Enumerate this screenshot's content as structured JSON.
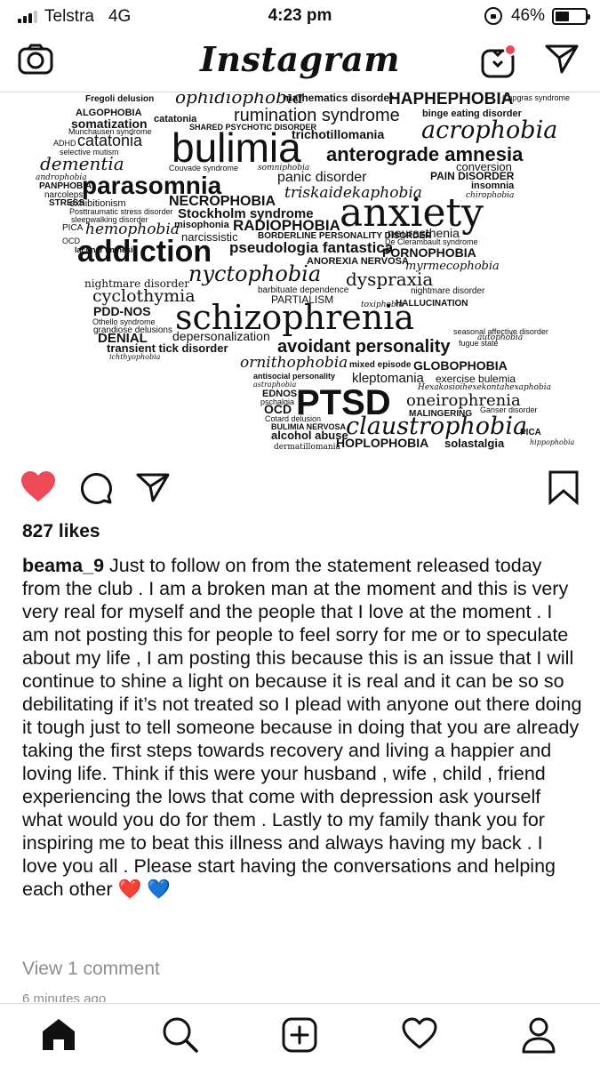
{
  "status_bar": {
    "carrier": "Telstra",
    "network": "4G",
    "time": "4:23 pm",
    "battery_percent_label": "46%",
    "battery_level": 0.46
  },
  "top_nav": {
    "logo": "Instagram",
    "icons": [
      "camera-icon",
      "igtv-icon",
      "direct-send-icon"
    ]
  },
  "post_image": {
    "words": [
      {
        "t": "ophidiophobia"
      },
      {
        "t": "mathematics disorder"
      },
      {
        "t": "HAPHEPHOBIA"
      },
      {
        "t": "Fregoli delusion"
      },
      {
        "t": "Capgras syndrome"
      },
      {
        "t": "ALGOPHOBIA"
      },
      {
        "t": "rumination syndrome"
      },
      {
        "t": "binge eating disorder"
      },
      {
        "t": "somatization"
      },
      {
        "t": "catatonia"
      },
      {
        "t": "Munchausen syndrome"
      },
      {
        "t": "SHARED PSYCHOTIC DISORDER"
      },
      {
        "t": "trichotillomania"
      },
      {
        "t": "acrophobia"
      },
      {
        "t": "ADHD"
      },
      {
        "t": "catatonia"
      },
      {
        "t": "bulimia"
      },
      {
        "t": "selective mutism"
      },
      {
        "t": "anterograde amnesia"
      },
      {
        "t": "dementia"
      },
      {
        "t": "Couvade syndrome"
      },
      {
        "t": "somniphobia"
      },
      {
        "t": "conversion"
      },
      {
        "t": "androphobia"
      },
      {
        "t": "PANPHOBIA"
      },
      {
        "t": "parasomnia"
      },
      {
        "t": "panic disorder"
      },
      {
        "t": "PAIN DISORDER"
      },
      {
        "t": "narcolepsy"
      },
      {
        "t": "insomnia"
      },
      {
        "t": "STRESS"
      },
      {
        "t": "triskaidekaphobia"
      },
      {
        "t": "chirophobia"
      },
      {
        "t": "exhibitionism"
      },
      {
        "t": "NECROPHOBIA"
      },
      {
        "t": "anxiety"
      },
      {
        "t": "Posttraumatic stress disorder"
      },
      {
        "t": "Stockholm syndrome"
      },
      {
        "t": "sleepwalking disorder"
      },
      {
        "t": "RADIOPHOBIA"
      },
      {
        "t": "PICA"
      },
      {
        "t": "hemophobia"
      },
      {
        "t": "misophonia"
      },
      {
        "t": "neurasthenia"
      },
      {
        "t": "narcissistic"
      },
      {
        "t": "BORDERLINE PERSONALITY DISORDER"
      },
      {
        "t": "De Clerambault syndrome"
      },
      {
        "t": "OCD"
      },
      {
        "t": "addiction"
      },
      {
        "t": "pseudologia fantastica"
      },
      {
        "t": "PORNOPHOBIA"
      },
      {
        "t": "lacunar amnesia"
      },
      {
        "t": "ANOREXIA NERVOSA"
      },
      {
        "t": "myrmecophobia"
      },
      {
        "t": "nyctophobia"
      },
      {
        "t": "dyspraxia"
      },
      {
        "t": "nightmare disorder"
      },
      {
        "t": "barbituate dependence"
      },
      {
        "t": "nightmare disorder"
      },
      {
        "t": "cyclothymia"
      },
      {
        "t": "PARTIALISM"
      },
      {
        "t": "toxiphobia"
      },
      {
        "t": "HALLUCINATION"
      },
      {
        "t": "PDD-NOS"
      },
      {
        "t": "Othello syndrome"
      },
      {
        "t": "schizophrenia"
      },
      {
        "t": "grandiose delusions"
      },
      {
        "t": "seasonal affective disorder"
      },
      {
        "t": "DENIAL"
      },
      {
        "t": "depersonalization"
      },
      {
        "t": "autophobia"
      },
      {
        "t": "transient tick disorder"
      },
      {
        "t": "avoidant personality"
      },
      {
        "t": "fugue state"
      },
      {
        "t": "ichthyophobia"
      },
      {
        "t": "ornithophobia"
      },
      {
        "t": "mixed episode"
      },
      {
        "t": "GLOBOPHOBIA"
      },
      {
        "t": "antisocial personality"
      },
      {
        "t": "kleptomania"
      },
      {
        "t": "exercise bulemia"
      },
      {
        "t": "astraphobia"
      },
      {
        "t": "Hexakosioihexekontahexaphobia"
      },
      {
        "t": "EDNOS"
      },
      {
        "t": "PTSD"
      },
      {
        "t": "pschalgia"
      },
      {
        "t": "oneirophrenia"
      },
      {
        "t": "OCD"
      },
      {
        "t": "MALINGERING"
      },
      {
        "t": "Ganser disorder"
      },
      {
        "t": "Cotard delusion"
      },
      {
        "t": "BULIMIA NERVOSA"
      },
      {
        "t": "claustrophobia"
      },
      {
        "t": "PICA"
      },
      {
        "t": "alcohol abuse"
      },
      {
        "t": "dermatillomania"
      },
      {
        "t": "HOPLOPHOBIA"
      },
      {
        "t": "solastalgia"
      },
      {
        "t": "hippophobia"
      }
    ]
  },
  "actions": {
    "liked": true,
    "like_color": "#ed4956",
    "icons": [
      "heart-icon",
      "comment-icon",
      "share-icon",
      "bookmark-icon"
    ]
  },
  "likes_label": "827 likes",
  "caption": {
    "username": "beama_9",
    "text": "Just to follow on from the statement released today from the club . I am a broken man at the moment and this is very very real for myself and the people that I love at the moment . I am not posting this for people to feel sorry for me or to speculate about my life , I am posting this because this is an issue that I will continue to shine a light on because it is real and it can be so so debilitating if it’s not treated so I plead with anyone out there doing it tough just to tell someone because in doing that you are already taking the first steps towards recovery and living a happier and loving life. Think if this were your husband , wife , child , friend experiencing the lows that come with depression ask yourself what would you do for them . Lastly to my family thank you for inspiring me to beat this illness and always having my back . I love you all . Please start having the conversations and helping each other ❤️ 💙"
  },
  "view_comments_label": "View 1 comment",
  "timestamp_label": "6 minutes ago",
  "bottom_tabs": [
    "home-icon",
    "search-icon",
    "new-post-icon",
    "activity-icon",
    "profile-icon"
  ]
}
